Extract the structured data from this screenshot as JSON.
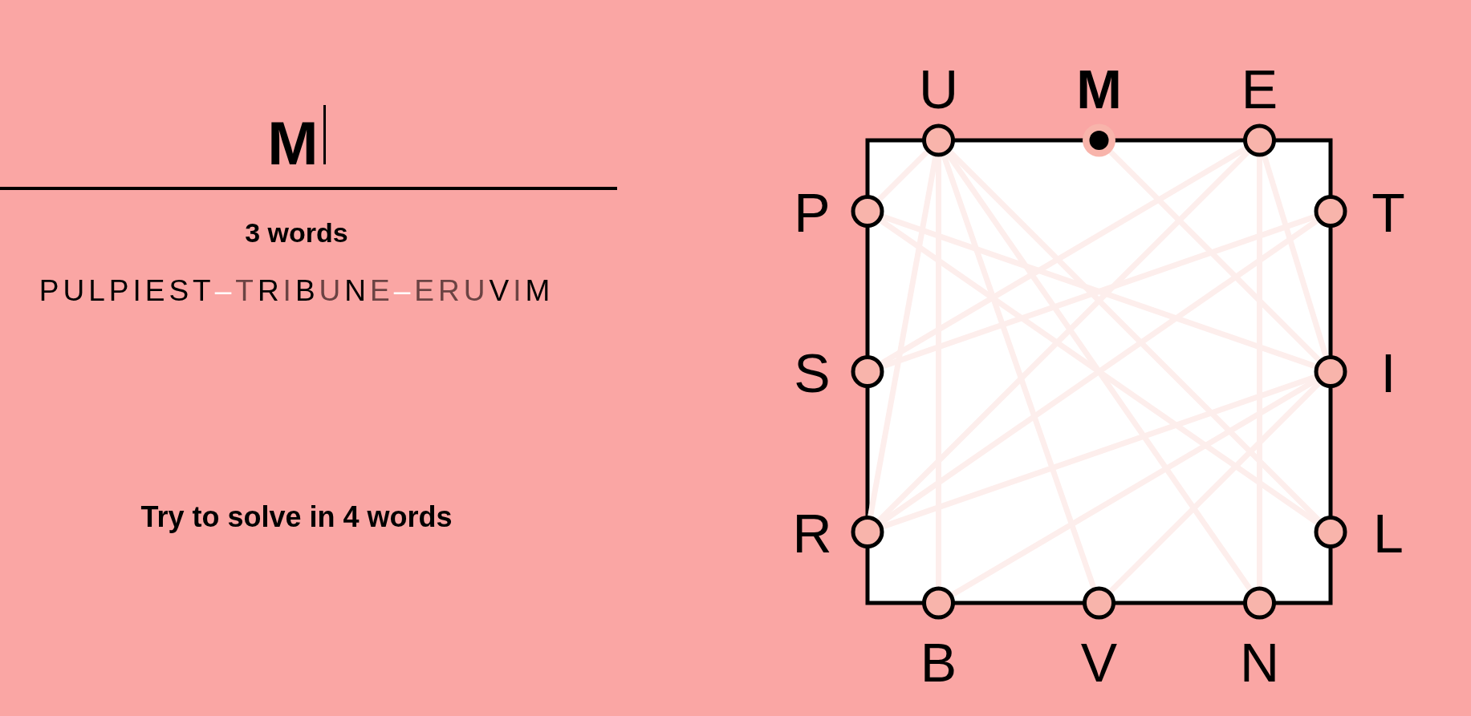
{
  "entry": {
    "value": "M"
  },
  "word_count": "3 words",
  "played_words": [
    {
      "letters": [
        {
          "char": "P",
          "reused": false
        },
        {
          "char": "U",
          "reused": false
        },
        {
          "char": "L",
          "reused": false
        },
        {
          "char": "P",
          "reused": false
        },
        {
          "char": "I",
          "reused": false
        },
        {
          "char": "E",
          "reused": false
        },
        {
          "char": "S",
          "reused": false
        },
        {
          "char": "T",
          "reused": false
        }
      ]
    },
    {
      "joiner": "–",
      "letters": [
        {
          "char": "T",
          "reused": true
        },
        {
          "char": "R",
          "reused": false
        },
        {
          "char": "I",
          "reused": true
        },
        {
          "char": "B",
          "reused": false
        },
        {
          "char": "U",
          "reused": true
        },
        {
          "char": "N",
          "reused": false
        },
        {
          "char": "E",
          "reused": true
        }
      ]
    },
    {
      "joiner": "–",
      "letters": [
        {
          "char": "E",
          "reused": true
        },
        {
          "char": "R",
          "reused": true
        },
        {
          "char": "U",
          "reused": true
        },
        {
          "char": "V",
          "reused": false
        },
        {
          "char": "I",
          "reused": true
        },
        {
          "char": "M",
          "reused": false
        }
      ]
    }
  ],
  "goal": "Try to solve in 4 words",
  "box": {
    "sides": [
      {
        "kind": "top",
        "letters": [
          {
            "letter": "U",
            "selected": false
          },
          {
            "letter": "M",
            "selected": true
          },
          {
            "letter": "E",
            "selected": false
          }
        ]
      },
      {
        "kind": "right",
        "letters": [
          {
            "letter": "T",
            "selected": false
          },
          {
            "letter": "I",
            "selected": false
          },
          {
            "letter": "L",
            "selected": false
          }
        ]
      },
      {
        "kind": "bottom",
        "letters": [
          {
            "letter": "B",
            "selected": false
          },
          {
            "letter": "V",
            "selected": false
          },
          {
            "letter": "N",
            "selected": false
          }
        ]
      },
      {
        "kind": "left",
        "letters": [
          {
            "letter": "P",
            "selected": false
          },
          {
            "letter": "S",
            "selected": false
          },
          {
            "letter": "R",
            "selected": false
          }
        ]
      }
    ]
  }
}
